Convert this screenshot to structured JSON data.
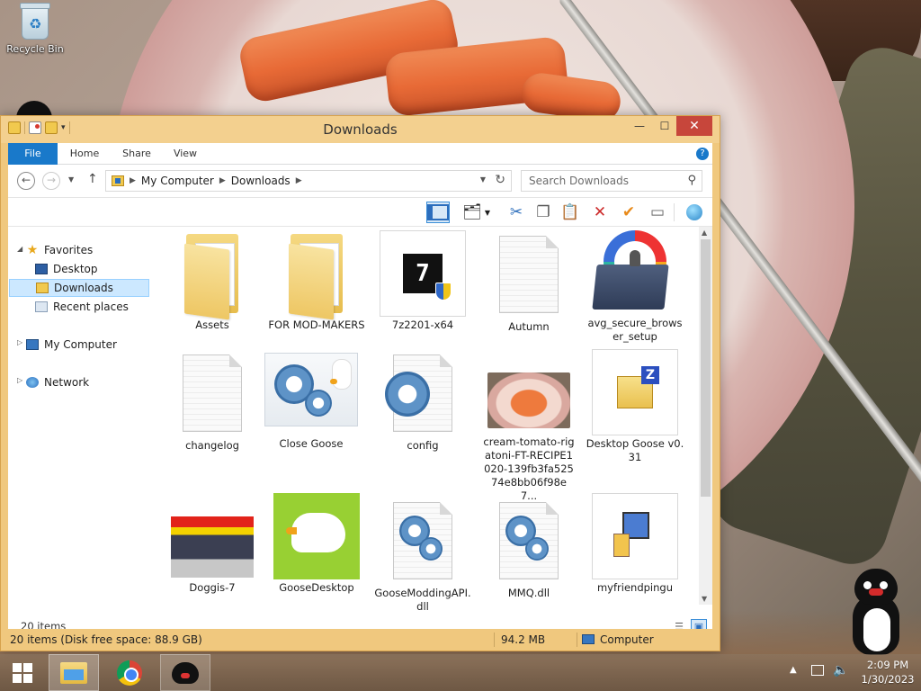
{
  "desktop": {
    "recycle_bin_label": "Recycle Bin"
  },
  "window": {
    "title": "Downloads",
    "controls": {
      "minimize": "—",
      "maximize": "☐",
      "close": "✕"
    }
  },
  "ribbon": {
    "tabs": [
      {
        "label": "File"
      },
      {
        "label": "Home"
      },
      {
        "label": "Share"
      },
      {
        "label": "View"
      }
    ],
    "help": "?"
  },
  "address": {
    "crumbs": [
      "My Computer",
      "Downloads"
    ],
    "search_placeholder": "Search Downloads"
  },
  "navpane": {
    "favorites": "Favorites",
    "desktop": "Desktop",
    "downloads": "Downloads",
    "recent": "Recent places",
    "computer": "My Computer",
    "network": "Network"
  },
  "files": [
    {
      "name": "Assets",
      "kind": "folder-icon"
    },
    {
      "name": "FOR MOD-MAKERS",
      "kind": "folder-icon"
    },
    {
      "name": "7z2201-x64",
      "kind": "7zip-installer-icon"
    },
    {
      "name": "Autumn",
      "kind": "document-icon"
    },
    {
      "name": "avg_secure_browser_setup",
      "kind": "avg-installer-icon"
    },
    {
      "name": "changelog",
      "kind": "document-icon"
    },
    {
      "name": "Close Goose",
      "kind": "shortcut-gear-icon"
    },
    {
      "name": "config",
      "kind": "config-gear-icon"
    },
    {
      "name": "cream-tomato-rigatoni-FT-RECIPE1020-139fb3fa52574e8bb06f98e7...",
      "kind": "image-thumbnail"
    },
    {
      "name": "Desktop Goose v0.31",
      "kind": "zip-archive-icon"
    },
    {
      "name": "Doggis-7",
      "kind": "image-thumbnail"
    },
    {
      "name": "GooseDesktop",
      "kind": "goose-app-icon"
    },
    {
      "name": "GooseModdingAPI.dll",
      "kind": "dll-gear-icon"
    },
    {
      "name": "MMQ.dll",
      "kind": "dll-gear-icon"
    },
    {
      "name": "myfriendpingu",
      "kind": "installer-icon"
    }
  ],
  "status": {
    "item_count": "20 items",
    "bar_items": "20 items (Disk free space: 88.9 GB)",
    "bar_size": "94.2 MB",
    "bar_location": "Computer"
  },
  "taskbar": {
    "time": "2:09 PM",
    "date": "1/30/2023"
  }
}
